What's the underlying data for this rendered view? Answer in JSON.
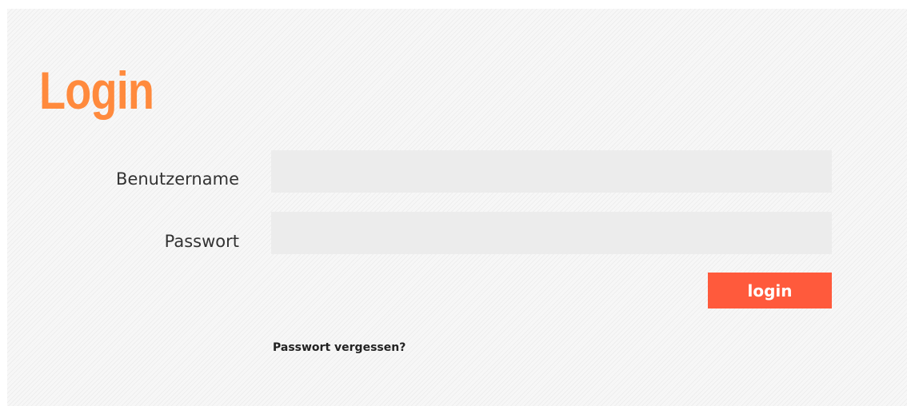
{
  "page": {
    "title": "Login"
  },
  "form": {
    "username_label": "Benutzername",
    "username_value": "",
    "password_label": "Passwort",
    "password_value": "",
    "submit_label": "login",
    "forgot_link": "Passwort vergessen?"
  },
  "colors": {
    "title": "#ff8a3d",
    "button": "#ff5a3c",
    "input_background": "#ececec",
    "panel_background": "#f7f7f7"
  }
}
